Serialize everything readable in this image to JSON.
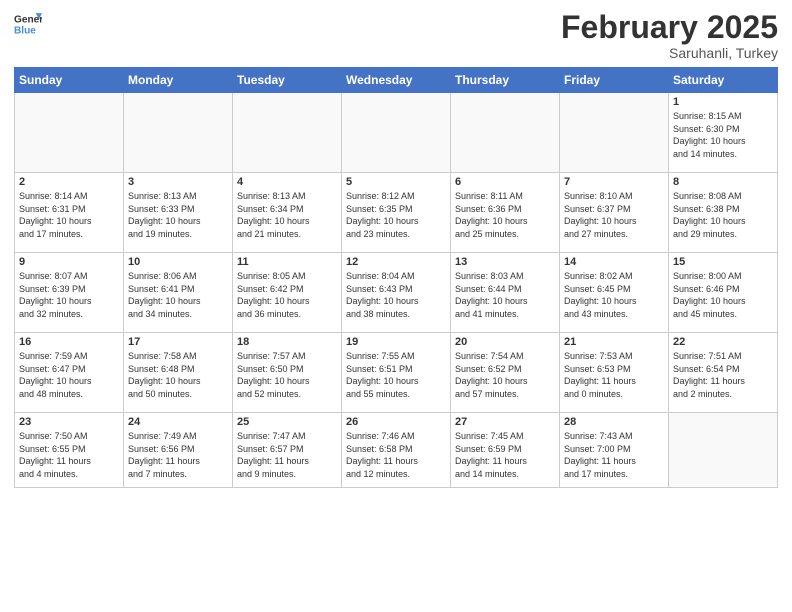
{
  "header": {
    "logo_general": "General",
    "logo_blue": "Blue",
    "month_title": "February 2025",
    "subtitle": "Saruhanli, Turkey"
  },
  "weekdays": [
    "Sunday",
    "Monday",
    "Tuesday",
    "Wednesday",
    "Thursday",
    "Friday",
    "Saturday"
  ],
  "weeks": [
    [
      {
        "day": "",
        "info": ""
      },
      {
        "day": "",
        "info": ""
      },
      {
        "day": "",
        "info": ""
      },
      {
        "day": "",
        "info": ""
      },
      {
        "day": "",
        "info": ""
      },
      {
        "day": "",
        "info": ""
      },
      {
        "day": "1",
        "info": "Sunrise: 8:15 AM\nSunset: 6:30 PM\nDaylight: 10 hours\nand 14 minutes."
      }
    ],
    [
      {
        "day": "2",
        "info": "Sunrise: 8:14 AM\nSunset: 6:31 PM\nDaylight: 10 hours\nand 17 minutes."
      },
      {
        "day": "3",
        "info": "Sunrise: 8:13 AM\nSunset: 6:33 PM\nDaylight: 10 hours\nand 19 minutes."
      },
      {
        "day": "4",
        "info": "Sunrise: 8:13 AM\nSunset: 6:34 PM\nDaylight: 10 hours\nand 21 minutes."
      },
      {
        "day": "5",
        "info": "Sunrise: 8:12 AM\nSunset: 6:35 PM\nDaylight: 10 hours\nand 23 minutes."
      },
      {
        "day": "6",
        "info": "Sunrise: 8:11 AM\nSunset: 6:36 PM\nDaylight: 10 hours\nand 25 minutes."
      },
      {
        "day": "7",
        "info": "Sunrise: 8:10 AM\nSunset: 6:37 PM\nDaylight: 10 hours\nand 27 minutes."
      },
      {
        "day": "8",
        "info": "Sunrise: 8:08 AM\nSunset: 6:38 PM\nDaylight: 10 hours\nand 29 minutes."
      }
    ],
    [
      {
        "day": "9",
        "info": "Sunrise: 8:07 AM\nSunset: 6:39 PM\nDaylight: 10 hours\nand 32 minutes."
      },
      {
        "day": "10",
        "info": "Sunrise: 8:06 AM\nSunset: 6:41 PM\nDaylight: 10 hours\nand 34 minutes."
      },
      {
        "day": "11",
        "info": "Sunrise: 8:05 AM\nSunset: 6:42 PM\nDaylight: 10 hours\nand 36 minutes."
      },
      {
        "day": "12",
        "info": "Sunrise: 8:04 AM\nSunset: 6:43 PM\nDaylight: 10 hours\nand 38 minutes."
      },
      {
        "day": "13",
        "info": "Sunrise: 8:03 AM\nSunset: 6:44 PM\nDaylight: 10 hours\nand 41 minutes."
      },
      {
        "day": "14",
        "info": "Sunrise: 8:02 AM\nSunset: 6:45 PM\nDaylight: 10 hours\nand 43 minutes."
      },
      {
        "day": "15",
        "info": "Sunrise: 8:00 AM\nSunset: 6:46 PM\nDaylight: 10 hours\nand 45 minutes."
      }
    ],
    [
      {
        "day": "16",
        "info": "Sunrise: 7:59 AM\nSunset: 6:47 PM\nDaylight: 10 hours\nand 48 minutes."
      },
      {
        "day": "17",
        "info": "Sunrise: 7:58 AM\nSunset: 6:48 PM\nDaylight: 10 hours\nand 50 minutes."
      },
      {
        "day": "18",
        "info": "Sunrise: 7:57 AM\nSunset: 6:50 PM\nDaylight: 10 hours\nand 52 minutes."
      },
      {
        "day": "19",
        "info": "Sunrise: 7:55 AM\nSunset: 6:51 PM\nDaylight: 10 hours\nand 55 minutes."
      },
      {
        "day": "20",
        "info": "Sunrise: 7:54 AM\nSunset: 6:52 PM\nDaylight: 10 hours\nand 57 minutes."
      },
      {
        "day": "21",
        "info": "Sunrise: 7:53 AM\nSunset: 6:53 PM\nDaylight: 11 hours\nand 0 minutes."
      },
      {
        "day": "22",
        "info": "Sunrise: 7:51 AM\nSunset: 6:54 PM\nDaylight: 11 hours\nand 2 minutes."
      }
    ],
    [
      {
        "day": "23",
        "info": "Sunrise: 7:50 AM\nSunset: 6:55 PM\nDaylight: 11 hours\nand 4 minutes."
      },
      {
        "day": "24",
        "info": "Sunrise: 7:49 AM\nSunset: 6:56 PM\nDaylight: 11 hours\nand 7 minutes."
      },
      {
        "day": "25",
        "info": "Sunrise: 7:47 AM\nSunset: 6:57 PM\nDaylight: 11 hours\nand 9 minutes."
      },
      {
        "day": "26",
        "info": "Sunrise: 7:46 AM\nSunset: 6:58 PM\nDaylight: 11 hours\nand 12 minutes."
      },
      {
        "day": "27",
        "info": "Sunrise: 7:45 AM\nSunset: 6:59 PM\nDaylight: 11 hours\nand 14 minutes."
      },
      {
        "day": "28",
        "info": "Sunrise: 7:43 AM\nSunset: 7:00 PM\nDaylight: 11 hours\nand 17 minutes."
      },
      {
        "day": "",
        "info": ""
      }
    ]
  ]
}
